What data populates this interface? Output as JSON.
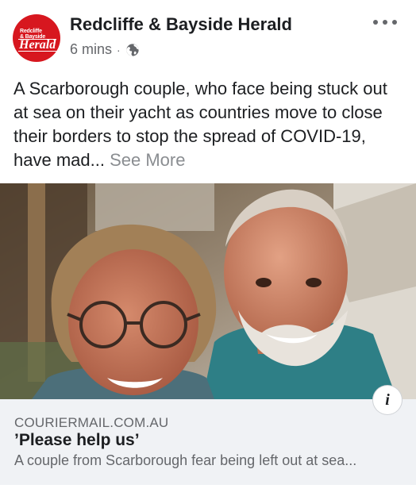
{
  "post": {
    "page_name": "Redcliffe & Bayside Herald",
    "avatar": {
      "logo_small_line1": "Redcliffe",
      "logo_small_line2": "& Bayside",
      "logo_big": "Herald",
      "brand_color": "#d7171f"
    },
    "timestamp": "6 mins",
    "separator": "·",
    "audience_icon": "globe-icon",
    "more_icon": "more-options-icon",
    "text": "A Scarborough couple, who face being stuck out at sea on their yacht as countries move to close their borders to stop the spread of COVID-19, have mad...",
    "see_more_label": "See More"
  },
  "link_preview": {
    "domain": "COURIERMAIL.COM.AU",
    "title": "’Please help us’",
    "description": "A couple from Scarborough fear being left out at sea...",
    "info_icon": "info-icon",
    "info_label": "i"
  },
  "colors": {
    "text_primary": "#1c1e21",
    "text_secondary": "#65676b",
    "see_more": "#8a8d91",
    "link_box_bg": "#f0f2f5"
  }
}
